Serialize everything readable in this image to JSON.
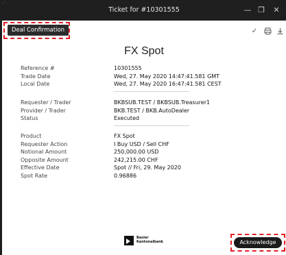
{
  "window": {
    "title": "Ticket for #10301555"
  },
  "window_controls": {
    "minimize": "—",
    "restore": "❐",
    "close": "✕"
  },
  "toolbar": {
    "tab_label": "Deal Confirmation",
    "icons": [
      "check-icon",
      "print-icon",
      "download-icon"
    ]
  },
  "main": {
    "heading": "FX Spot",
    "groups": [
      [
        {
          "label": "Reference #",
          "value": "10301555"
        },
        {
          "label": "Trade Date",
          "value": "Wed, 27. May 2020 14:47:41.581 GMT"
        },
        {
          "label": "Local Date",
          "value": "Wed, 27. May 2020 16:47:41.581 CEST"
        }
      ],
      [
        {
          "label": "Requester / Trader",
          "value": "BKBSUB.TEST / BKBSUB.Treasurer1"
        },
        {
          "label": "Provider / Trader",
          "value": "BKB.TEST / BKB.AutoDealer"
        },
        {
          "label": "Status",
          "value": "Executed"
        }
      ],
      [
        {
          "label": "Product",
          "value": "FX Spot"
        },
        {
          "label": "Requester Action",
          "value": "I Buy USD / Sell CHF"
        },
        {
          "label": "Notional Amount",
          "value": "250,000.00 USD"
        },
        {
          "label": "Opposite Amount",
          "value": "242,215.00 CHF"
        },
        {
          "label": "Effective Date",
          "value": "Spot // Fri, 29. May 2020"
        },
        {
          "label": "Spot Rate",
          "value": "0.96886"
        }
      ]
    ]
  },
  "footer": {
    "logo_line1": "Basler",
    "logo_line2": "Kantonalbank",
    "acknowledge_label": "Acknowledge"
  },
  "colors": {
    "highlight": "#e31b23",
    "titlebar": "#1f1f1f"
  }
}
